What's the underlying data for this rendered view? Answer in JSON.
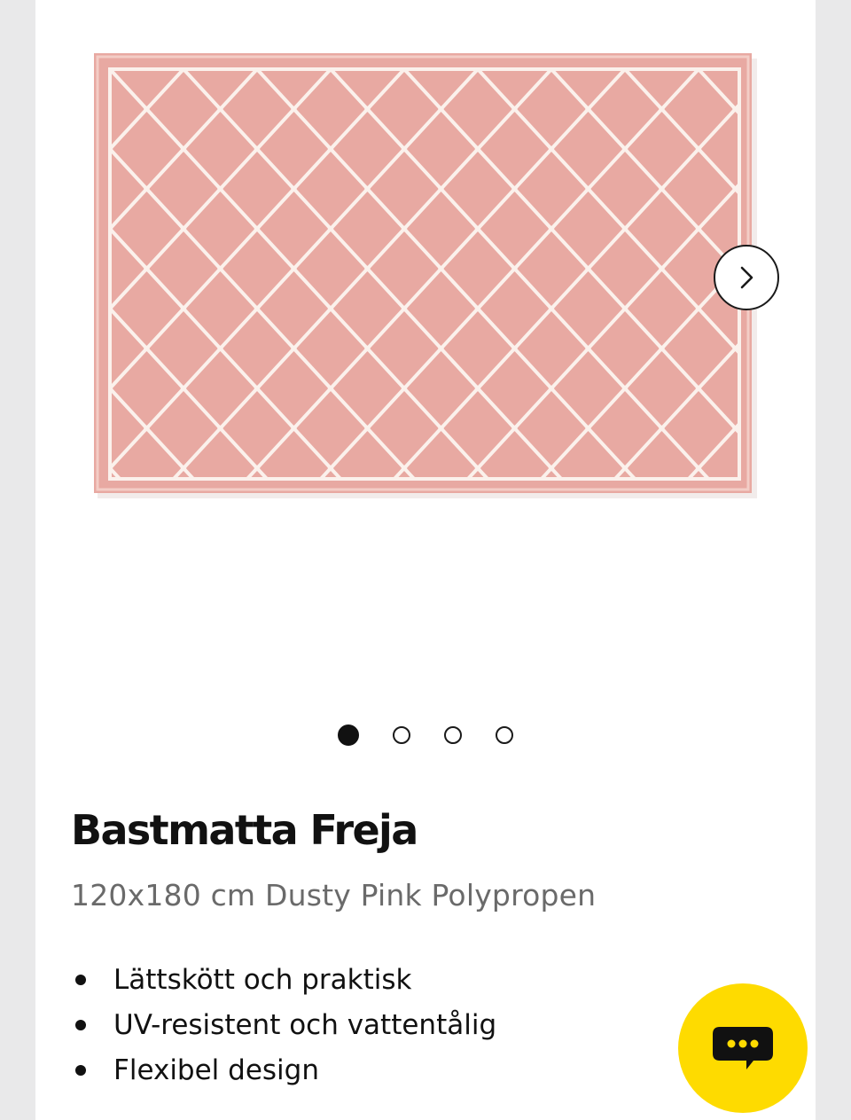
{
  "gallery": {
    "image_alt": "Bastmatta Freja",
    "next_icon": "chevron-right-icon",
    "rug_color": "#e8a9a2",
    "pattern_color": "#fbf1ec",
    "slides": [
      {
        "active": true
      },
      {
        "active": false
      },
      {
        "active": false
      },
      {
        "active": false
      }
    ]
  },
  "product": {
    "title": "Bastmatta Freja",
    "subtitle": "120x180 cm Dusty Pink Polypropen",
    "features": [
      "Lättskött och praktisk",
      "UV-resistent och vattentålig",
      "Flexibel design"
    ]
  },
  "chat": {
    "icon": "chat-bubble-icon",
    "color": "#fedb00"
  }
}
